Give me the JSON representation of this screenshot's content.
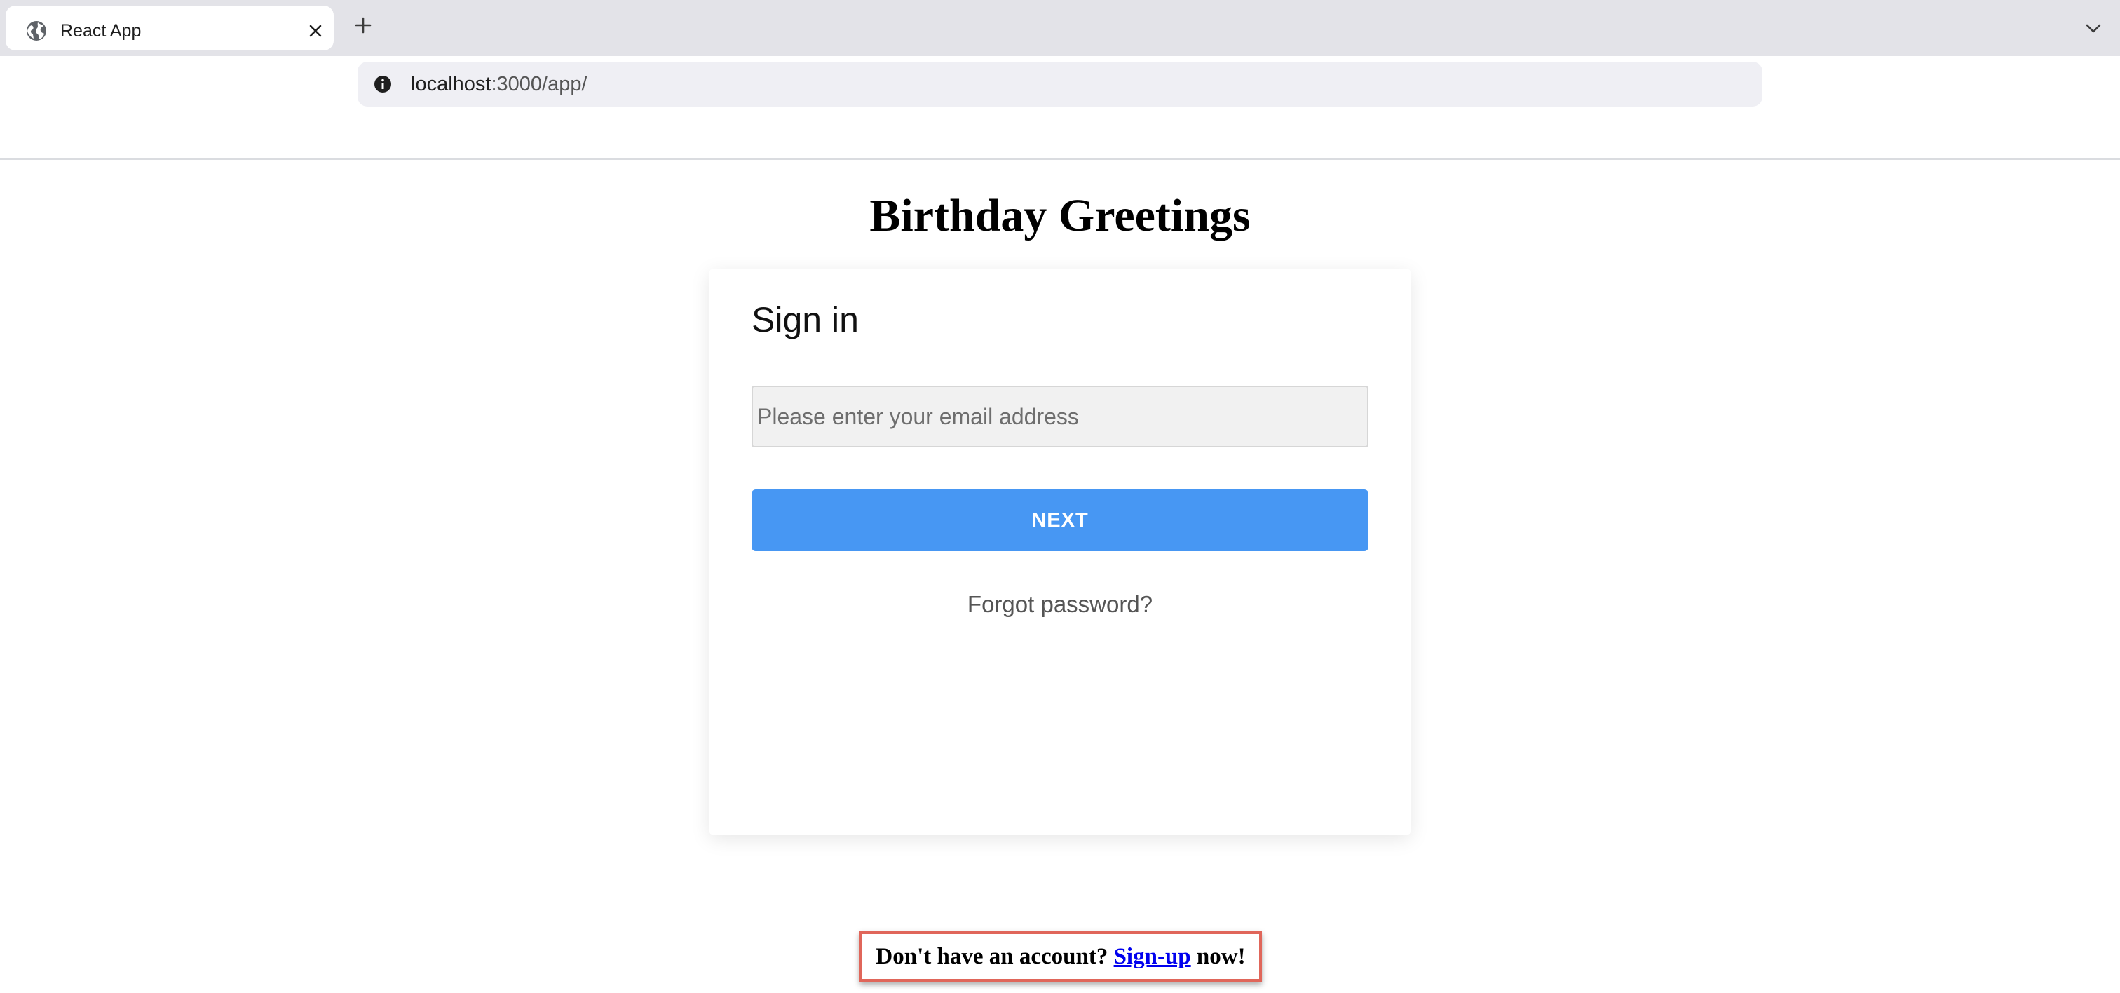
{
  "browser": {
    "tab_title": "React App",
    "url_host": "localhost",
    "url_path": ":3000/app/"
  },
  "app": {
    "title": "Birthday Greetings"
  },
  "signin": {
    "heading": "Sign in",
    "email_placeholder": "Please enter your email address",
    "email_value": "",
    "next_label": "NEXT",
    "forgot_label": "Forgot password?"
  },
  "signup": {
    "prefix": "Don't have an account? ",
    "link_label": "Sign-up",
    "suffix": " now!"
  },
  "colors": {
    "primary_button": "#4797f3",
    "highlight_border": "#e0665a",
    "link": "#0000ee"
  }
}
